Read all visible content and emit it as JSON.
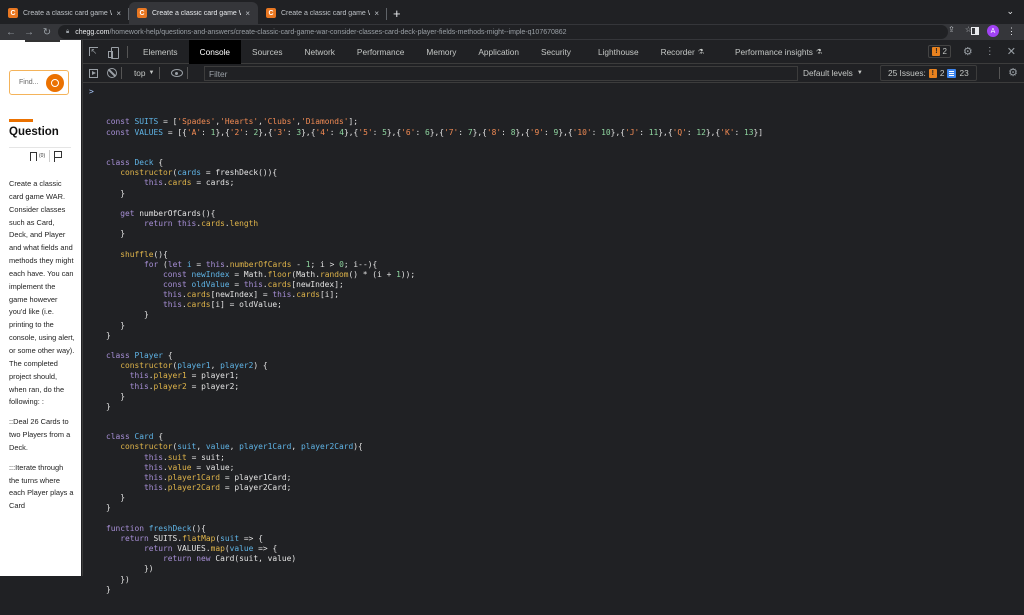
{
  "browser": {
    "tabs": [
      {
        "title": "Create a classic card game WA",
        "favicon": "C",
        "active": false
      },
      {
        "title": "Create a classic card game WA",
        "favicon": "C",
        "active": true
      },
      {
        "title": "Create a classic card game WA",
        "favicon": "C",
        "active": false
      }
    ],
    "new_tab_label": "+",
    "tab_close": "×",
    "url_host": "chegg.com",
    "url_path": "/homework-help/questions-and-answers/create-classic-card-game-war-consider-classes-card-deck-player-fields-methods-might--imple-q107670862",
    "profile_initial": "A",
    "colors": {
      "favicon": "#e87722",
      "avatar": "#a142f4"
    }
  },
  "page": {
    "search_placeholder": "Find...",
    "question_heading": "Question",
    "bookmark_count": "(0)",
    "question_paragraphs": [
      "Create a classic card game WAR. Consider classes such as Card, Deck, and Player and what fields and methods they might each have. You can implement the game however you'd like (i.e. printing to the console, using alert, or some other way). The completed project should, when ran, do the following: :",
      "::Deal 26 Cards to two Players from a Deck.",
      ":::Iterate through the turns where each Player plays a Card"
    ],
    "colors": {
      "accent": "#eb7100"
    }
  },
  "devtools": {
    "tabs": [
      "Elements",
      "Console",
      "Sources",
      "Network",
      "Performance",
      "Memory",
      "Application",
      "Security",
      "Lighthouse",
      "Recorder",
      "Performance insights"
    ],
    "active_tab": "Console",
    "experimental_tabs": [
      "Recorder",
      "Performance insights"
    ],
    "warning_count": "2",
    "context": "top",
    "filter_placeholder": "Filter",
    "levels_label": "Default levels",
    "issues_label": "25 Issues:",
    "issues_warnings": "2",
    "issues_info": "23",
    "colors": {
      "warning": "#e8821f",
      "info": "#3c85f0"
    }
  },
  "console": {
    "prompt": ">",
    "lines": [
      "const SUITS = ['Spades','Hearts','Clubs','Diamonds'];",
      "const VALUES = [{'A': 1},{'2': 2},{'3': 3},{'4': 4},{'5': 5},{'6': 6},{'7': 7},{'8': 8},{'9': 9},{'10': 10},{'J': 11},{'Q': 12},{'K': 13}]",
      "",
      "",
      "class Deck {",
      "   constructor(cards = freshDeck()){",
      "        this.cards = cards;",
      "   }",
      "",
      "   get numberOfCards(){",
      "        return this.cards.length",
      "   }",
      "",
      "   shuffle(){",
      "        for (let i = this.numberOfCards - 1; i > 0; i--){",
      "            const newIndex = Math.floor(Math.random() * (i + 1));",
      "            const oldValue = this.cards[newIndex];",
      "            this.cards[newIndex] = this.cards[i];",
      "            this.cards[i] = oldValue;",
      "        }",
      "   }",
      "}",
      "",
      "class Player {",
      "   constructor(player1, player2) {",
      "     this.player1 = player1;",
      "     this.player2 = player2;",
      "   }",
      "}",
      "",
      "",
      "class Card {",
      "   constructor(suit, value, player1Card, player2Card){",
      "        this.suit = suit;",
      "        this.value = value;",
      "        this.player1Card = player1Card;",
      "        this.player2Card = player2Card;",
      "   }",
      "}",
      "",
      "function freshDeck(){",
      "   return SUITS.flatMap(suit => {",
      "        return VALUES.map(value => {",
      "            return new Card(suit, value)",
      "        })",
      "   })",
      "}"
    ]
  }
}
